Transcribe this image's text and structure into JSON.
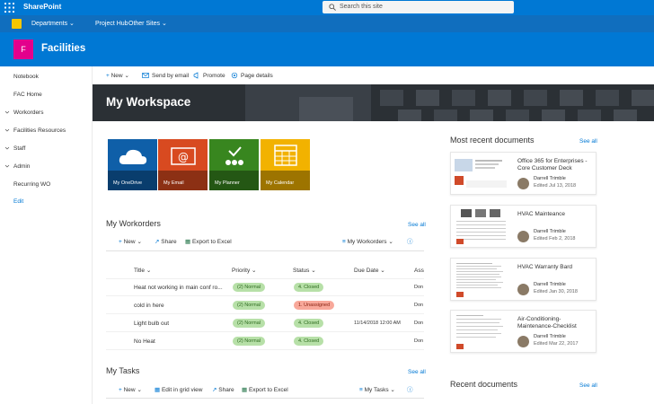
{
  "suite": {
    "brand": "SharePoint",
    "search_placeholder": "Search this site"
  },
  "hub": {
    "items": [
      "Departments",
      "Project Hub",
      "Other Sites"
    ]
  },
  "site": {
    "logo_letter": "F",
    "title": "Facilities"
  },
  "leftnav": {
    "items": [
      "Notebook",
      "FAC Home",
      "Workorders",
      "Facilities Resources",
      "Staff",
      "Admin",
      "Recurring WO"
    ],
    "edit": "Edit"
  },
  "cmdbar": {
    "new": "New",
    "send": "Send by email",
    "promote": "Promote",
    "details": "Page details"
  },
  "banner": {
    "title": "My Workspace"
  },
  "tiles": [
    "My OneDrive",
    "My Email",
    "My Planner",
    "My Calendar"
  ],
  "workorders": {
    "title": "My Workorders",
    "see_all": "See all",
    "cmd": {
      "new": "New",
      "share": "Share",
      "export": "Export to Excel",
      "view": "My Workorders"
    },
    "columns": [
      "Title",
      "Priority",
      "Status",
      "Due Date",
      "Ass"
    ],
    "rows": [
      {
        "title": "Heat not working in main conf ro...",
        "priority": "(2) Normal",
        "status": "4. Closed",
        "due": "",
        "assigned": "Don"
      },
      {
        "title": "cold in here",
        "priority": "(2) Normal",
        "status": "1. Unassigned",
        "due": "",
        "assigned": "Don"
      },
      {
        "title": "Light bulb out",
        "priority": "(2) Normal",
        "status": "4. Closed",
        "due": "11/14/2018 12:00 AM",
        "assigned": "Don"
      },
      {
        "title": "No Heat",
        "priority": "(2) Normal",
        "status": "4. Closed",
        "due": "",
        "assigned": "Don"
      }
    ]
  },
  "tasks": {
    "title": "My Tasks",
    "see_all": "See all",
    "cmd": {
      "new": "New",
      "edit_grid": "Edit in grid view",
      "share": "Share",
      "export": "Export to Excel",
      "view": "My Tasks"
    }
  },
  "recent_docs": {
    "title": "Most recent documents",
    "see_all": "See all",
    "items": [
      {
        "title": "Office 365 for Enterprises - Core Customer Deck",
        "author": "Darrell Trimble",
        "edited": "Edited Jul 13, 2018"
      },
      {
        "title": "HVAC Mainteance",
        "author": "Darrell Trimble",
        "edited": "Edited Feb 2, 2018"
      },
      {
        "title": "HVAC Warranty Bard",
        "author": "Darrell Trimble",
        "edited": "Edited Jan 30, 2018"
      },
      {
        "title": "Air-Conditioning-Maintenance-Checklist",
        "author": "Darrell Trimble",
        "edited": "Edited Mar 22, 2017"
      }
    ]
  },
  "recent_docs2": {
    "title": "Recent documents",
    "see_all": "See all"
  },
  "colors": {
    "suite": "#0078d4",
    "hub": "#106ebe",
    "site_logo": "#e3008c",
    "accent": "#0078d4"
  }
}
